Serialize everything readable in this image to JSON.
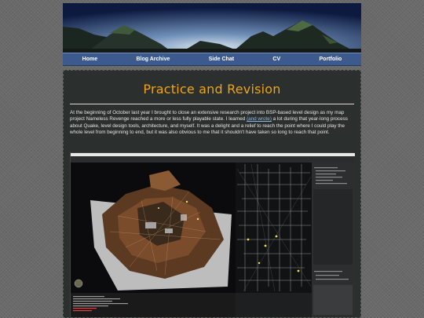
{
  "nav": {
    "items": [
      {
        "label": "Home"
      },
      {
        "label": "Blog Archive"
      },
      {
        "label": "Side Chat"
      },
      {
        "label": "CV"
      },
      {
        "label": "Portfolio"
      }
    ]
  },
  "post": {
    "title": "Practice and Revision",
    "body_part1": "At the beginning of October last year I brought to close an extensive research project into BSP-based level design as my map project Nameless Revenge reached a more or less fully playable state. I learned ",
    "body_link": "(and wrote)",
    "body_part2": " a lot during that year-long process about Quake, level design tools, architecture, and myself. It was a delight and a relief to reach the point where I could play the whole level from beginning to end, but it was also obvious to me that it shouldn't have taken so long to reach that point."
  },
  "colors": {
    "accent": "#f0a416",
    "nav_bg": "#3c5a8e",
    "link": "#8fb6e8",
    "content_bg": "#2b2f2d"
  }
}
